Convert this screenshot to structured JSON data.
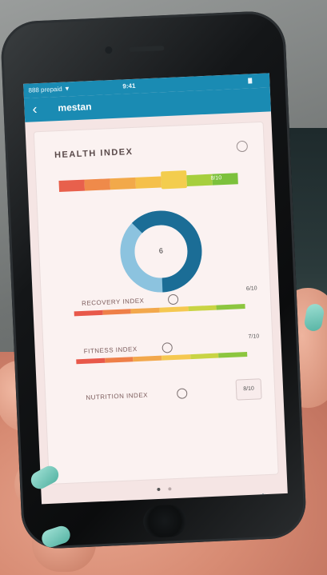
{
  "statusbar": {
    "carrier": "888 prepaid ▼",
    "time": "9:41"
  },
  "appbar": {
    "back_glyph": "‹",
    "title": "mestan"
  },
  "health": {
    "title": "HEALTH INDEX",
    "bar_label": "8/10",
    "score": "6",
    "score_fraction": 0.62
  },
  "sub_indices": [
    {
      "label": "RECOVERY INDEX",
      "value": "6/10"
    },
    {
      "label": "FITNESS INDEX",
      "value": "7/10"
    },
    {
      "label": "NUTRITION INDEX",
      "value": "8/10"
    }
  ],
  "colors": {
    "brand": "#1a8bb3",
    "donut_dark": "#1b6d96",
    "donut_light": "#8cc3df"
  },
  "bottom_nav": [
    {
      "icon": "calendar-icon",
      "glyph": "▦"
    },
    {
      "icon": "chart-icon",
      "glyph": "⛰"
    },
    {
      "icon": "target-icon",
      "glyph": "◎"
    },
    {
      "icon": "list-icon",
      "glyph": "▤"
    },
    {
      "icon": "settings-icon",
      "glyph": "⚙"
    }
  ]
}
